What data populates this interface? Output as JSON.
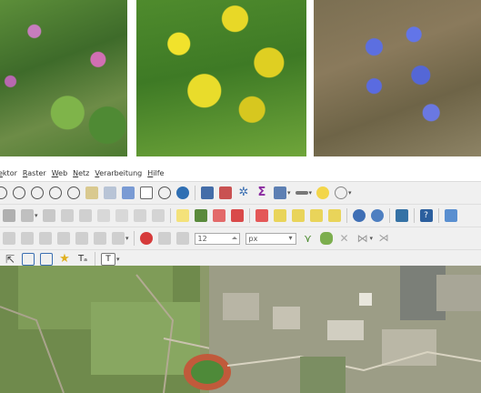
{
  "menu": {
    "items": [
      "ektor",
      "Raster",
      "Web",
      "Netz",
      "Verarbeitung",
      "Hilfe"
    ]
  },
  "toolbar": {
    "scale_value": "12",
    "unit_value": "px",
    "text_tool_label": "T"
  },
  "colors": {
    "toolbar_bg": "#f0f0f0",
    "menubar_bg": "#ffffff",
    "aerial_green": "#8c9a6a"
  },
  "icons": {
    "row1": [
      "zoom-in-icon",
      "zoom-out-icon",
      "zoom-rubberband-icon",
      "zoom-layer-icon",
      "zoom-selection-icon",
      "zoom-last-icon",
      "new-bookmark-icon",
      "show-bookmarks-icon",
      "temporal-controller-icon",
      "refresh-icon",
      "identify-icon",
      "attribute-table-icon",
      "settings-icon",
      "statistics-icon",
      "field-calculator-icon",
      "measure-icon",
      "map-tips-icon",
      "annotation-icon"
    ],
    "row2": [
      "digitize-icon",
      "node-tool-icon",
      "save-edits-icon",
      "delete-icon",
      "cut-icon",
      "copy-icon",
      "paste-icon",
      "undo-icon",
      "redo-icon",
      "label-abc-icon",
      "label-pin-icon",
      "label-red-icon",
      "label-edit-icon",
      "label-move-icon",
      "label-rotate-icon",
      "label-change-icon",
      "label-props-icon",
      "plugin-globe-icon",
      "plugin-globe2-icon",
      "python-icon",
      "help-icon",
      "processing-icon"
    ],
    "row3": [
      "advanced-digitize-icon",
      "reshape-icon",
      "rotate-feature-icon",
      "simplify-icon",
      "add-ring-icon",
      "add-part-icon",
      "fill-ring-icon",
      "delete-ring-icon",
      "split-icon",
      "magnet-icon",
      "trace-icon",
      "offset-icon",
      "trim-icon",
      "reverse-icon",
      "merge-icon",
      "cross-icon"
    ],
    "row4": [
      "select-icon",
      "vertex-tool-icon",
      "shape-icon",
      "favorite-icon",
      "text-annotation-icon"
    ]
  }
}
